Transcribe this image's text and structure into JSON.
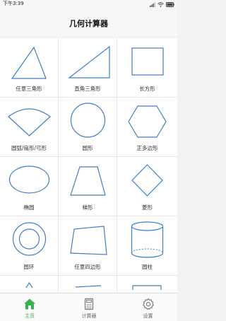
{
  "status_bar": {
    "time": "下午3:39"
  },
  "header": {
    "title": "几何计算器"
  },
  "shapes": [
    {
      "label": "任意三角形",
      "icon": "triangle-icon"
    },
    {
      "label": "直角三角形",
      "icon": "right-triangle-icon"
    },
    {
      "label": "长方形",
      "icon": "rectangle-icon"
    },
    {
      "label": "圆弧/扇形/弓形",
      "icon": "sector-icon"
    },
    {
      "label": "圆形",
      "icon": "circle-icon"
    },
    {
      "label": "正多边形",
      "icon": "hexagon-icon"
    },
    {
      "label": "椭圆",
      "icon": "ellipse-icon"
    },
    {
      "label": "梯形",
      "icon": "trapezoid-icon"
    },
    {
      "label": "菱形",
      "icon": "rhombus-icon"
    },
    {
      "label": "圆环",
      "icon": "ring-icon"
    },
    {
      "label": "任意四边形",
      "icon": "quadrilateral-icon"
    },
    {
      "label": "圆柱",
      "icon": "cylinder-icon"
    }
  ],
  "tabs": [
    {
      "label": "主页",
      "icon": "home-icon",
      "active": true
    },
    {
      "label": "计算器",
      "icon": "calculator-icon",
      "active": false
    },
    {
      "label": "设置",
      "icon": "gear-icon",
      "active": false
    }
  ],
  "colors": {
    "shape_stroke": "#3f7fc4",
    "active_tab": "#38b54a",
    "inactive_tab": "#777777"
  }
}
